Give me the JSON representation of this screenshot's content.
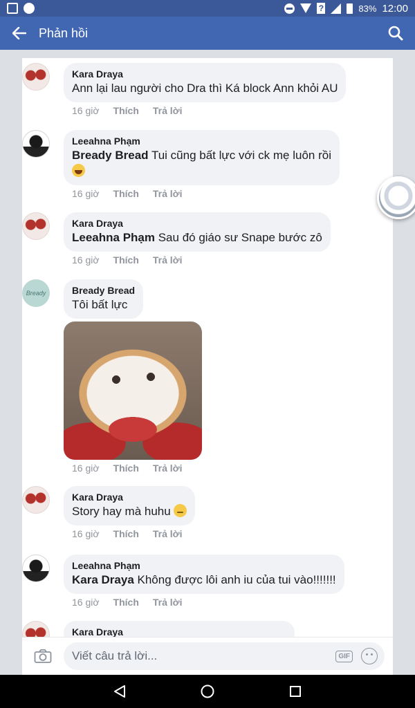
{
  "status_bar": {
    "battery": "83%",
    "time": "12:00"
  },
  "header": {
    "title": "Phản hồi"
  },
  "comments": [
    {
      "author": "Kara Draya",
      "mention": "",
      "text": "Ann lại lau người cho Dra thì Ká block Ann khỏi AU",
      "time": "16 giờ",
      "like": "Thích",
      "reply": "Trả lời"
    },
    {
      "author": "Leeahna Phạm",
      "mention": "Bready Bread",
      "text": " Tui cũng bất lực với ck mẹ luôn rồi",
      "time": "16 giờ",
      "like": "Thích",
      "reply": "Trả lời"
    },
    {
      "author": "Kara Draya",
      "mention": "Leeahna Phạm",
      "text": " Sau đó giáo sư Snape bước zô",
      "time": "16 giờ",
      "like": "Thích",
      "reply": "Trả lời"
    },
    {
      "author": "Bready Bread",
      "mention": "",
      "text": "Tôi bất lực",
      "time": "16 giờ",
      "like": "Thích",
      "reply": "Trả lời"
    },
    {
      "author": "Kara Draya",
      "mention": "",
      "text": "Story hay mà huhu ",
      "time": "16 giờ",
      "like": "Thích",
      "reply": "Trả lời"
    },
    {
      "author": "Leeahna Phạm",
      "mention": "Kara Draya",
      "text": " Không được lôi anh iu của tui vào!!!!!!!",
      "time": "16 giờ",
      "like": "Thích",
      "reply": "Trả lời"
    },
    {
      "author": "Kara Draya"
    }
  ],
  "avatar_labels": {
    "bread": "Bready"
  },
  "compose": {
    "placeholder": "Viết câu trả lời...",
    "gif_label": "GIF"
  },
  "colors": {
    "brand": "#4267b2",
    "status_bar": "#3b5998",
    "bubble": "#f0f2f5",
    "meta_text": "#90949c"
  }
}
